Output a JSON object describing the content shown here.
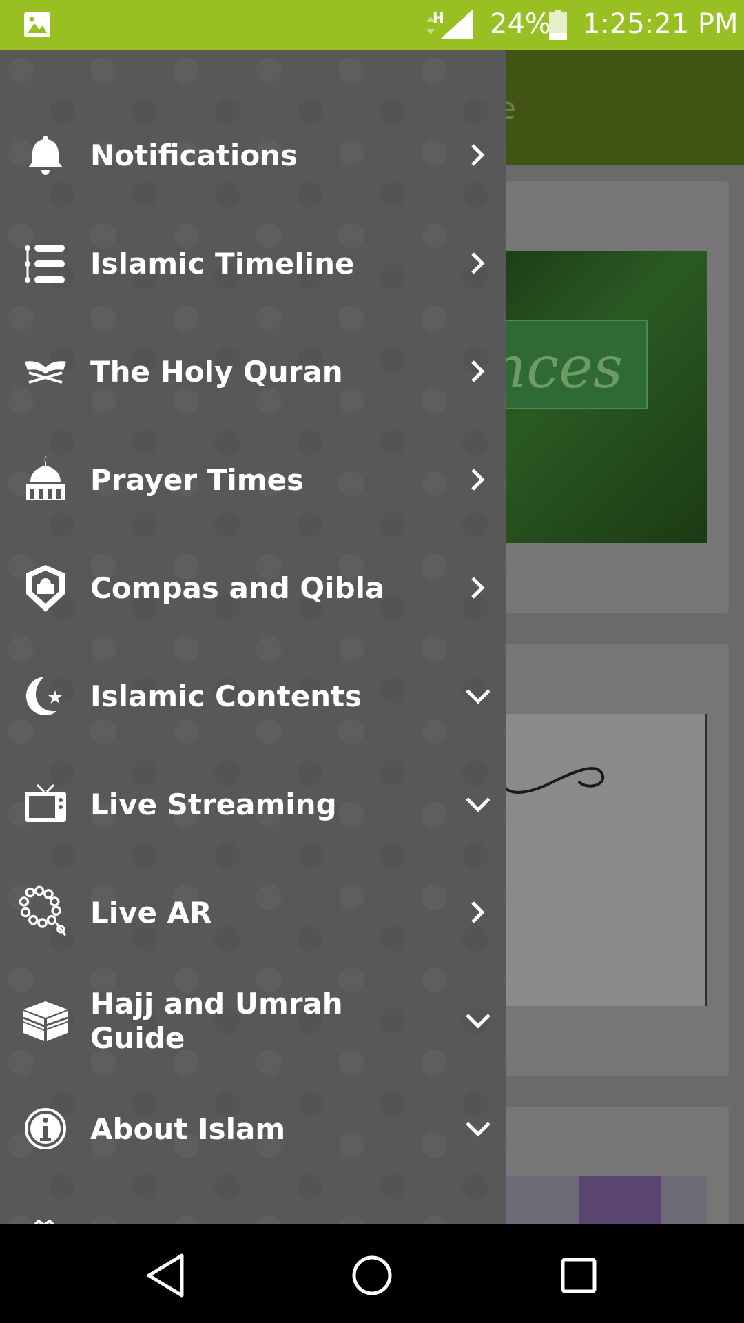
{
  "status_bar": {
    "network_type": "H",
    "battery": "24%",
    "time": "1:25:21 PM"
  },
  "drawer": {
    "items": [
      {
        "label": "Notifications",
        "icon": "bell-icon",
        "indicator": "chevron-right"
      },
      {
        "label": "Islamic Timeline",
        "icon": "timeline-list-icon",
        "indicator": "chevron-right"
      },
      {
        "label": "The Holy Quran",
        "icon": "quran-book-icon",
        "indicator": "chevron-right"
      },
      {
        "label": "Prayer Times",
        "icon": "mosque-icon",
        "indicator": "chevron-right"
      },
      {
        "label": "Compas and Qibla",
        "icon": "qibla-pin-icon",
        "indicator": "chevron-right"
      },
      {
        "label": "Islamic Contents",
        "icon": "crescent-star-icon",
        "indicator": "chevron-down"
      },
      {
        "label": "Live Streaming",
        "icon": "tv-icon",
        "indicator": "chevron-down"
      },
      {
        "label": "Live AR",
        "icon": "prayer-beads-icon",
        "indicator": "chevron-right"
      },
      {
        "label": "Hajj and Umrah Guide",
        "icon": "kaaba-icon",
        "indicator": "chevron-down"
      },
      {
        "label": "About Islam",
        "icon": "info-icon",
        "indicator": "chevron-down"
      }
    ]
  },
  "background": {
    "toolbar_fragment": "e",
    "card1_text": "nces"
  },
  "colors": {
    "status_bar": "#98c023",
    "drawer": "#585858",
    "toolbar_dimmed": "#425413"
  }
}
